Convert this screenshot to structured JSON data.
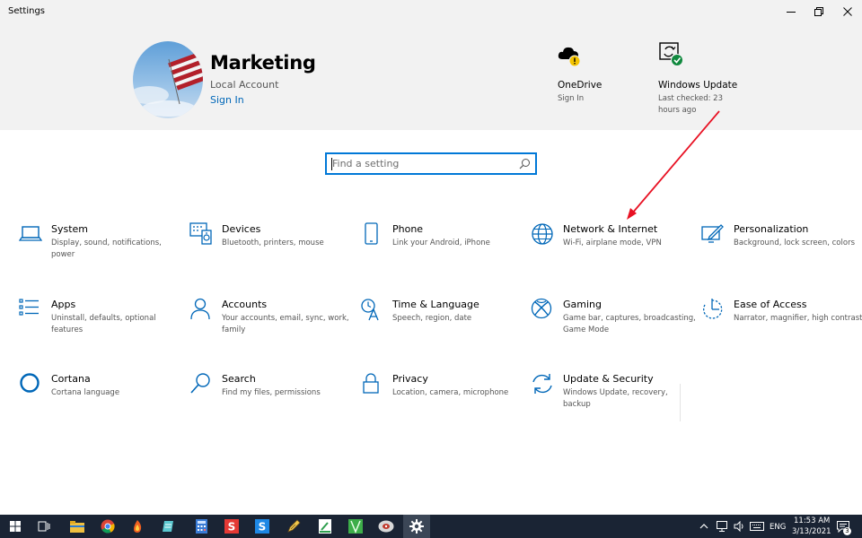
{
  "window": {
    "title": "Settings"
  },
  "account": {
    "name": "Marketing",
    "type": "Local Account",
    "sign_in": "Sign In"
  },
  "onedrive": {
    "title": "OneDrive",
    "status": "Sign In",
    "icon": "cloud-warning-icon"
  },
  "windows_update": {
    "title": "Windows Update",
    "status_line1": "Last checked: 23",
    "status_line2": "hours ago",
    "icon": "update-check-icon"
  },
  "search": {
    "placeholder": "Find a setting"
  },
  "categories": [
    {
      "name": "System",
      "desc": "Display, sound, notifications, power",
      "icon": "laptop-icon"
    },
    {
      "name": "Devices",
      "desc": "Bluetooth, printers, mouse",
      "icon": "devices-icon"
    },
    {
      "name": "Phone",
      "desc": "Link your Android, iPhone",
      "icon": "phone-icon"
    },
    {
      "name": "Network & Internet",
      "desc": "Wi-Fi, airplane mode, VPN",
      "icon": "globe-icon"
    },
    {
      "name": "Personalization",
      "desc": "Background, lock screen, colors",
      "icon": "paint-icon"
    },
    {
      "name": "Apps",
      "desc": "Uninstall, defaults, optional features",
      "icon": "apps-list-icon"
    },
    {
      "name": "Accounts",
      "desc": "Your accounts, email, sync, work, family",
      "icon": "person-icon"
    },
    {
      "name": "Time & Language",
      "desc": "Speech, region, date",
      "icon": "time-language-icon"
    },
    {
      "name": "Gaming",
      "desc": "Game bar, captures, broadcasting, Game Mode",
      "icon": "xbox-icon"
    },
    {
      "name": "Ease of Access",
      "desc": "Narrator, magnifier, high contrast",
      "icon": "ease-of-access-icon"
    },
    {
      "name": "Cortana",
      "desc": "Cortana language",
      "icon": "cortana-icon"
    },
    {
      "name": "Search",
      "desc": "Find my files, permissions",
      "icon": "search-icon"
    },
    {
      "name": "Privacy",
      "desc": "Location, camera, microphone",
      "icon": "lock-icon"
    },
    {
      "name": "Update & Security",
      "desc": "Windows Update, recovery, backup",
      "icon": "sync-icon"
    }
  ],
  "colors": {
    "accent": "#0078d7",
    "icon_blue": "#0067b8",
    "annotation_arrow": "#e81123",
    "taskbar": "#1a2434"
  },
  "taskbar": {
    "language": "ENG",
    "time": "11:53 AM",
    "date": "3/13/2021",
    "notification_count": "3"
  }
}
